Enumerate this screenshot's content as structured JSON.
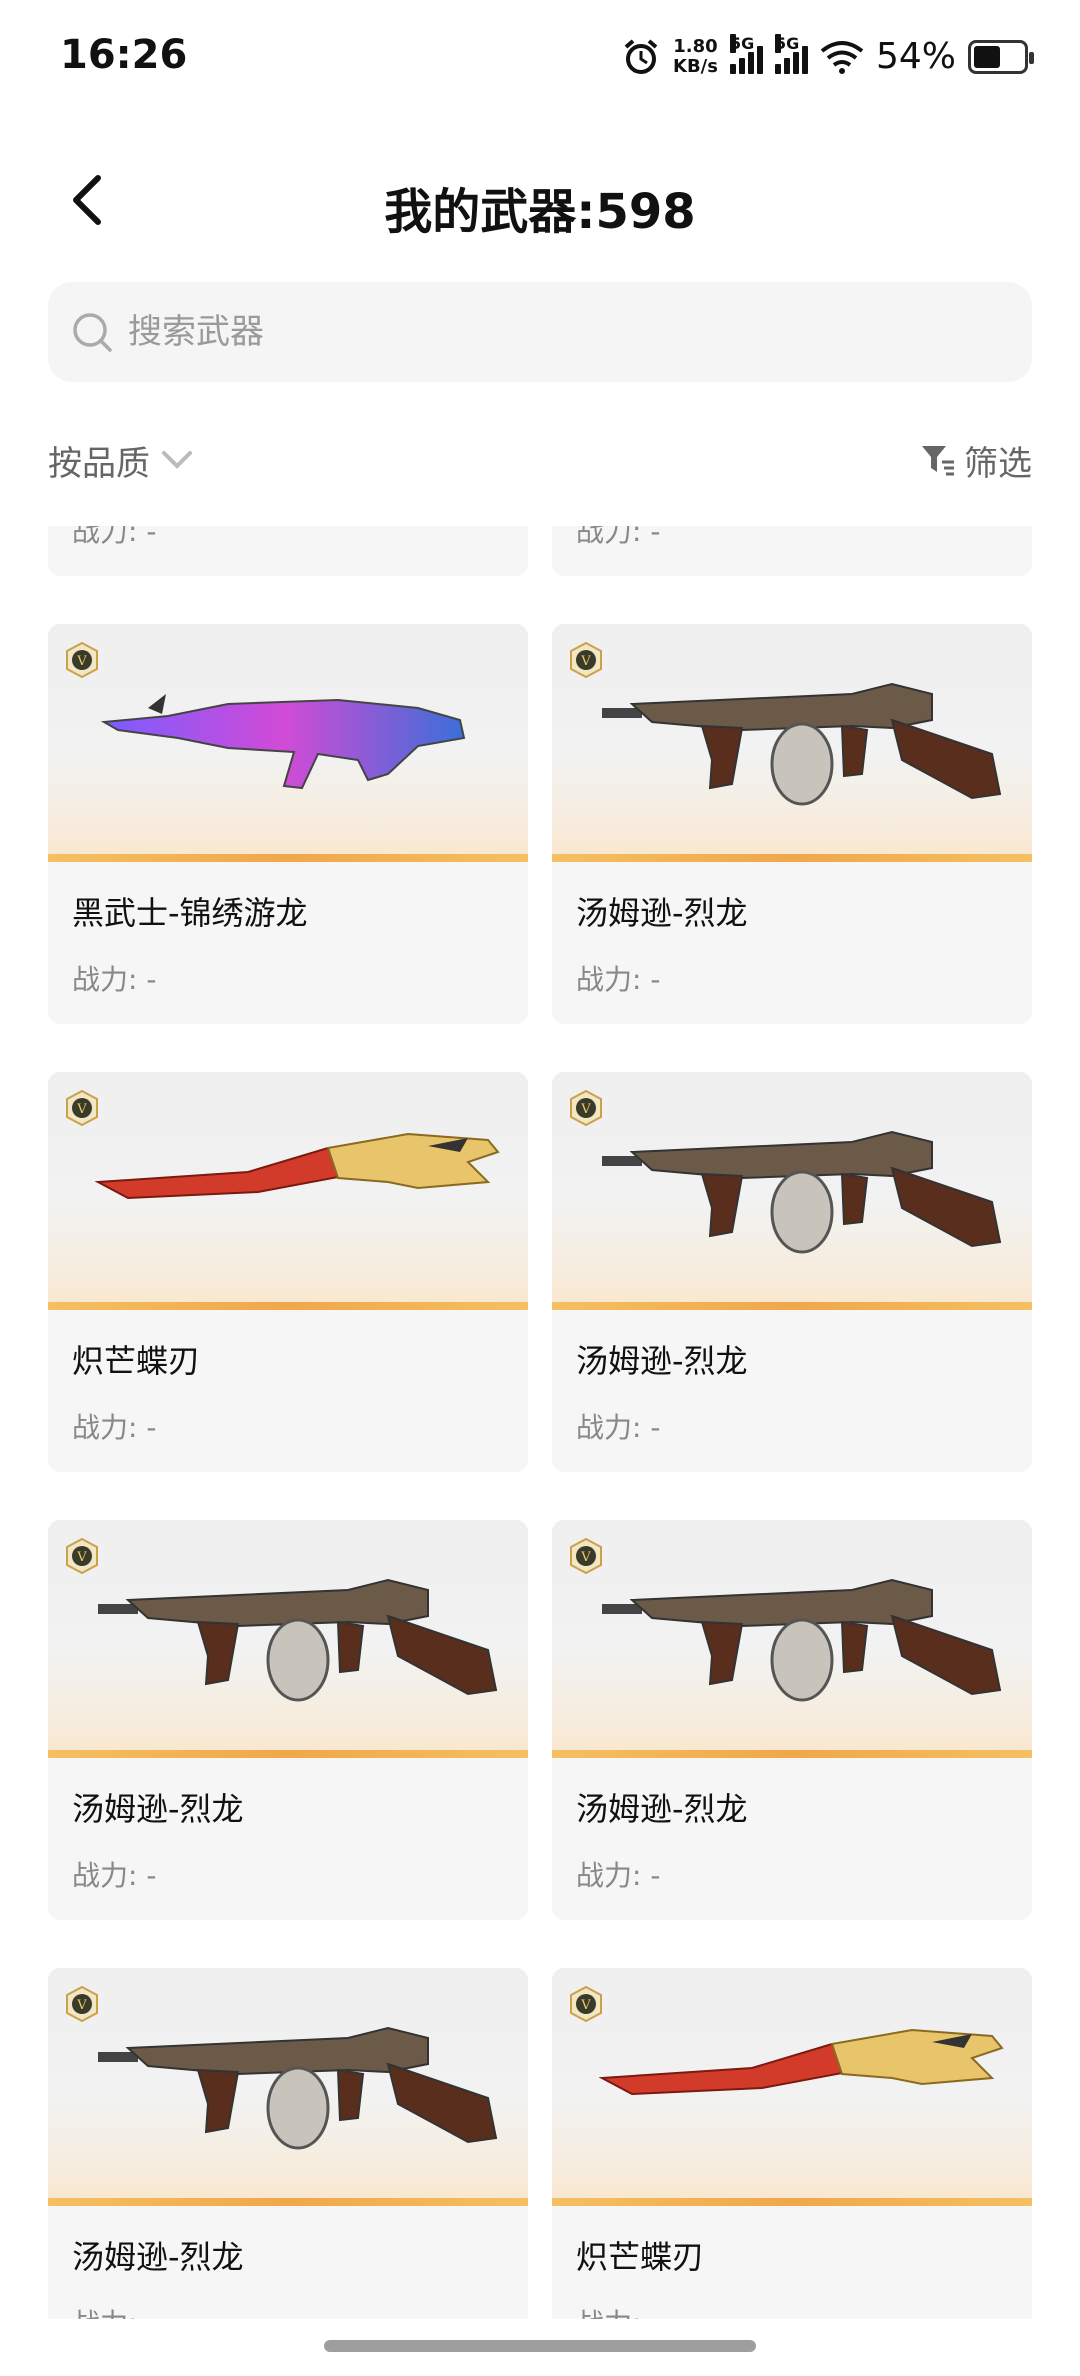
{
  "status": {
    "time": "16:26",
    "net_speed": "1.80",
    "net_unit": "KB/s",
    "sig1": "5G",
    "sig2": "5G",
    "battery": "54%"
  },
  "header": {
    "title": "我的武器:598"
  },
  "search": {
    "placeholder": "搜索武器"
  },
  "filters": {
    "sort_label": "按品质",
    "filter_label": "筛选"
  },
  "partial_top": {
    "power_left": "战力: -",
    "power_right": "战力: -"
  },
  "cards": [
    {
      "name": "黑武士-锦绣游龙",
      "power": "战力: -",
      "weapon": "rifle"
    },
    {
      "name": "汤姆逊-烈龙",
      "power": "战力: -",
      "weapon": "tommy"
    },
    {
      "name": "炽芒蝶刃",
      "power": "战力: -",
      "weapon": "blade"
    },
    {
      "name": "汤姆逊-烈龙",
      "power": "战力: -",
      "weapon": "tommy"
    },
    {
      "name": "汤姆逊-烈龙",
      "power": "战力: -",
      "weapon": "tommy"
    },
    {
      "name": "汤姆逊-烈龙",
      "power": "战力: -",
      "weapon": "tommy"
    },
    {
      "name": "汤姆逊-烈龙",
      "power": "战力: -",
      "weapon": "tommy"
    },
    {
      "name": "炽芒蝶刃",
      "power": "战力: -",
      "weapon": "blade"
    }
  ],
  "badge_letter": "V"
}
